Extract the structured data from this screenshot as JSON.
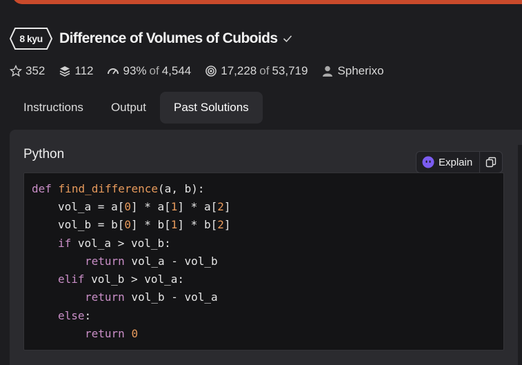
{
  "kata": {
    "rank": "8 kyu",
    "title": "Difference of Volumes of Cuboids"
  },
  "stats": {
    "stars": "352",
    "collections": "112",
    "satisfaction": "93%",
    "satisfaction_of_label": "of",
    "satisfaction_votes": "4,544",
    "completed": "17,228",
    "completed_of_label": "of",
    "attempted": "53,719",
    "author": "Spherixo"
  },
  "tabs": [
    {
      "label": "Instructions"
    },
    {
      "label": "Output"
    },
    {
      "label": "Past Solutions"
    }
  ],
  "active_tab": "Past Solutions",
  "solution": {
    "language": "Python",
    "explain_label": "Explain",
    "code": {
      "l1": {
        "t1": "def",
        "t2": "find_difference",
        "t3": "(a, b):"
      },
      "l2": {
        "t1": "vol_a = a[",
        "t2": "0",
        "t3": "] * a[",
        "t4": "1",
        "t5": "] * a[",
        "t6": "2",
        "t7": "]"
      },
      "l3": {
        "t1": "vol_b = b[",
        "t2": "0",
        "t3": "] * b[",
        "t4": "1",
        "t5": "] * b[",
        "t6": "2",
        "t7": "]"
      },
      "l4": {
        "t1": "if",
        "t2": " vol_a > vol_b:"
      },
      "l5": {
        "t1": "return",
        "t2": " vol_a - vol_b"
      },
      "l6": {
        "t1": "elif",
        "t2": " vol_b > vol_a:"
      },
      "l7": {
        "t1": "return",
        "t2": " vol_b - vol_a"
      },
      "l8": {
        "t1": "else",
        "t2": ":"
      },
      "l9": {
        "t1": "return",
        "t2": "0"
      }
    }
  },
  "colors": {
    "banner": "#c94a2b",
    "keyword": "#c98ec7",
    "function_and_number": "#e79a5c",
    "explain_icon": "#7b5cf0"
  },
  "icons": [
    "check-icon",
    "star-icon",
    "collections-icon",
    "satisfaction-gauge-icon",
    "target-icon",
    "user-icon",
    "ghost-ai-icon",
    "copy-icon"
  ]
}
